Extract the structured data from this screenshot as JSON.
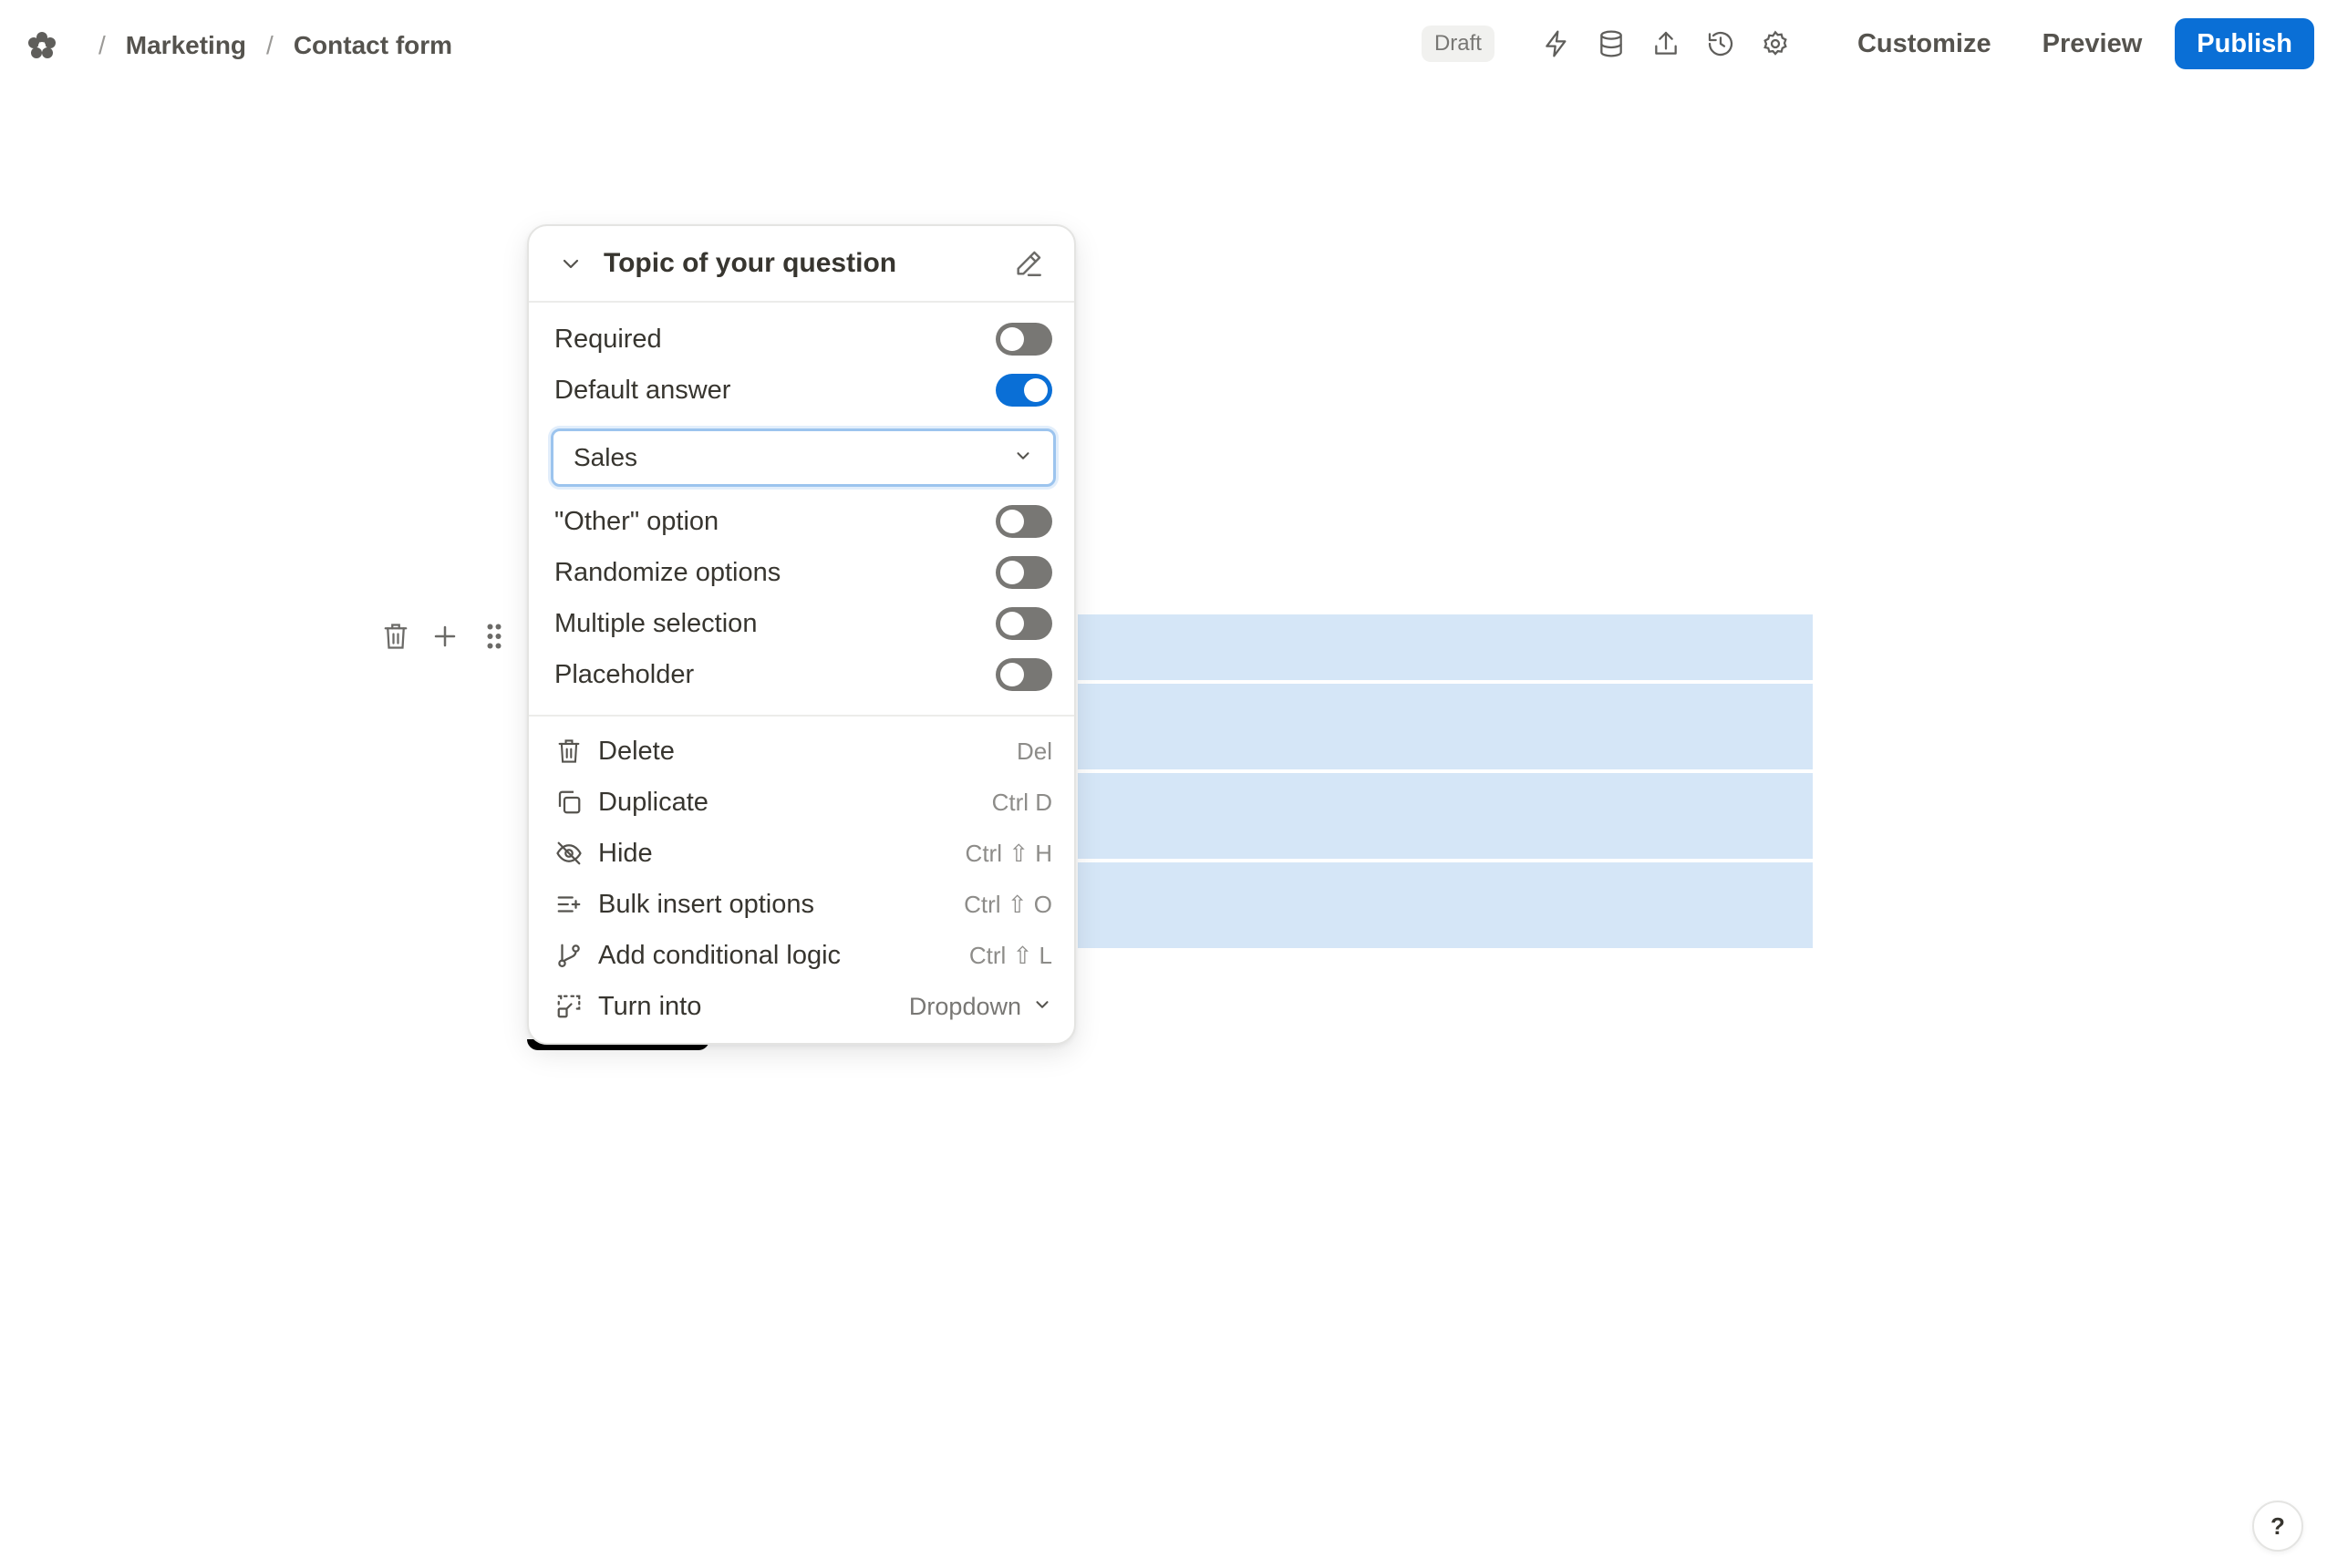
{
  "breadcrumb": {
    "items": [
      "Marketing",
      "Contact form"
    ],
    "separator": "/"
  },
  "header": {
    "status_badge": "Draft",
    "icons": [
      "lightning-icon",
      "database-icon",
      "share-icon",
      "history-icon",
      "gear-icon"
    ],
    "customize_label": "Customize",
    "preview_label": "Preview",
    "publish_label": "Publish"
  },
  "panel": {
    "title": "Topic of your question",
    "settings": [
      {
        "label": "Required",
        "on": false
      },
      {
        "label": "Default answer",
        "on": true
      }
    ],
    "default_answer_value": "Sales",
    "settings_more": [
      {
        "label": "\"Other\" option",
        "on": false
      },
      {
        "label": "Randomize options",
        "on": false
      },
      {
        "label": "Multiple selection",
        "on": false
      },
      {
        "label": "Placeholder",
        "on": false
      }
    ],
    "menu": [
      {
        "label": "Delete",
        "shortcut": "Del",
        "icon": "trash-icon"
      },
      {
        "label": "Duplicate",
        "shortcut": "Ctrl D",
        "icon": "duplicate-icon"
      },
      {
        "label": "Hide",
        "shortcut": "Ctrl ⇧ H",
        "icon": "eye-off-icon"
      },
      {
        "label": "Bulk insert options",
        "shortcut": "Ctrl ⇧ O",
        "icon": "bulk-insert-icon"
      },
      {
        "label": "Add conditional logic",
        "shortcut": "Ctrl ⇧ L",
        "icon": "branch-icon"
      }
    ],
    "turn_into": {
      "label": "Turn into",
      "value": "Dropdown",
      "icon": "transform-icon"
    }
  },
  "help_label": "?",
  "colors": {
    "accent": "#0a6fd6",
    "toggle_off": "#787774",
    "option_highlight": "#d5e6f7"
  }
}
